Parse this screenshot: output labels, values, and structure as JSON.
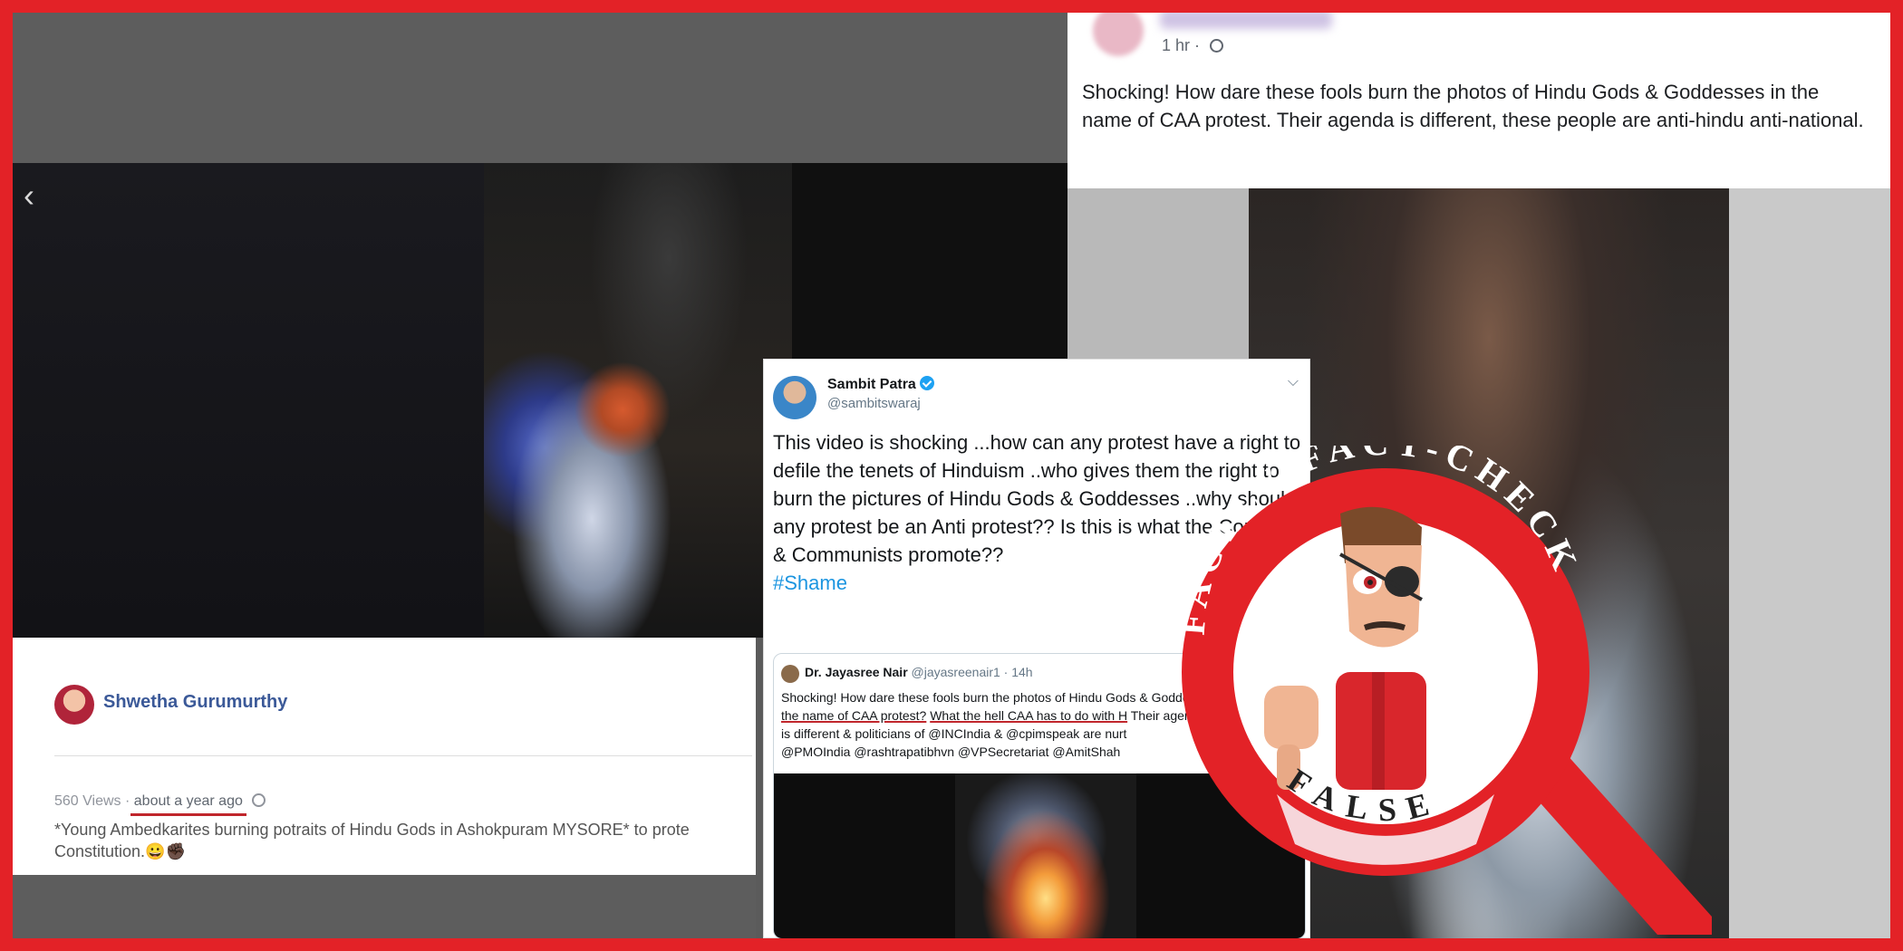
{
  "left_panel": {
    "author": "Shwetha Gurumurthy",
    "views": "560 Views",
    "separator": "·",
    "time_ago": "about a year ago",
    "description_line1": "*Young Ambedkarites burning potraits of Hindu Gods in Ashokpuram MYSORE* to prote",
    "description_line2": "Constitution.😀✊🏿"
  },
  "right_post": {
    "time": "1 hr ·",
    "text": "Shocking! How dare these fools burn the photos of Hindu Gods & Goddesses in the name of CAA protest. Their agenda is different, these people are anti-hindu anti-national."
  },
  "tweet": {
    "name": "Sambit Patra",
    "handle": "@sambitswaraj",
    "text": "This video is shocking ...how can any protest have a right to defile the tenets of Hinduism ..who gives them the right to burn the pictures of Hindu Gods & Goddesses ..why should any protest be an Anti protest?? Is this is what the Congress & Communists promote??",
    "hashtag": "#Shame",
    "quote": {
      "name": "Dr. Jayasree Nair",
      "handle": "@jayasreenair1 · 14h",
      "line1": "Shocking! How dare these fools burn the photos of Hindu Gods & Goddesses in",
      "line2a": "the name of CAA protest?",
      "line2b": "What the hell CAA has to do with H",
      "line2c": "Their agend",
      "line3": "is different & politicians of @INCIndia & @cpimspeak are nurt",
      "line4": "@PMOIndia @rashtrapatibhvn @VPSecretariat @AmitShah"
    }
  },
  "stamp": {
    "arc_text": "FACTLY FACT-CHECK",
    "verdict": "FALSE"
  },
  "colors": {
    "brand_red": "#e32227",
    "facebook_blue": "#3b5998",
    "twitter_blue": "#1da1f2"
  },
  "icons": [
    "chevron-left-icon",
    "globe-icon",
    "verified-badge-icon",
    "chevron-down-icon",
    "magnifier-icon"
  ]
}
